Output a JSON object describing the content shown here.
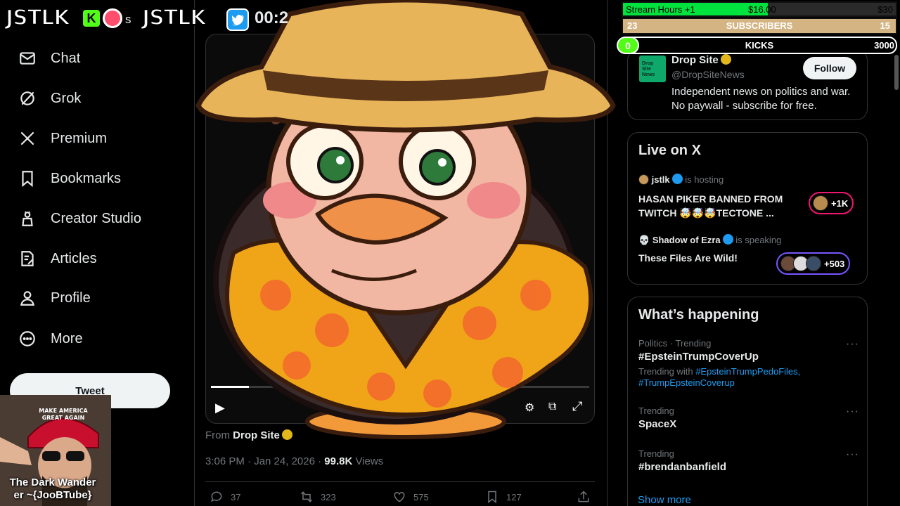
{
  "nav": {
    "items": [
      {
        "label": "Chat",
        "icon": "mail-icon"
      },
      {
        "label": "Grok",
        "icon": "grok-icon"
      },
      {
        "label": "Premium",
        "icon": "x-logo-icon"
      },
      {
        "label": "Bookmarks",
        "icon": "bookmark-icon"
      },
      {
        "label": "Creator Studio",
        "icon": "creator-studio-icon"
      },
      {
        "label": "Articles",
        "icon": "articles-icon"
      },
      {
        "label": "Profile",
        "icon": "profile-icon"
      },
      {
        "label": "More",
        "icon": "more-circle-icon"
      }
    ],
    "tweet_button": "Tweet"
  },
  "overlay": {
    "logo_left": "JSTLK",
    "kick_letter": "K",
    "s_fragment": "s",
    "logo_center": "JSTLK",
    "time_fragment": "00:2"
  },
  "post": {
    "from_prefix": "From",
    "from_name": "Drop Site",
    "time": "3:06 PM · Jan 24, 2026 ·",
    "views_count": "99.8K",
    "views_label": "Views",
    "replies": "37",
    "reposts": "323",
    "likes": "575",
    "bookmarks": "127",
    "video_progress": 0.1
  },
  "who_to_follow": {
    "name": "Drop Site",
    "handle": "@DropSiteNews",
    "bio_line1": "Independent news on politics and war.",
    "bio_line2": "No paywall - subscribe for free.",
    "follow_label": "Follow",
    "avatar_text": "Drop Site News"
  },
  "live_on_x": {
    "title": "Live on X",
    "entries": [
      {
        "host": "jstlk",
        "status": "is hosting",
        "title_line1": "HASAN PIKER BANNED FROM",
        "title_line2": "TWITCH 🤯🤯🤯TECTONE ...",
        "count": "+1K"
      },
      {
        "host": "Shadow of Ezra",
        "status": "is speaking",
        "title_line1": "These Files Are Wild!",
        "title_line2": "",
        "count": "+503"
      }
    ]
  },
  "whats_happening": {
    "title": "What’s happening",
    "trends": [
      {
        "context": "Politics · Trending",
        "name": "#EpsteinTrumpCoverUp",
        "with_prefix": "Trending with",
        "with_tag1": "#EpsteinTrumpPedoFiles,",
        "with_tag2": "#TrumpEpsteinCoverup"
      },
      {
        "context": "Trending",
        "name": "SpaceX"
      },
      {
        "context": "Trending",
        "name": "#brendanbanfield"
      }
    ],
    "dots": "···",
    "show_more": "Show more"
  },
  "stream_bars": {
    "hours_label": "Stream Hours +1",
    "hours_current": "$16.00",
    "hours_goal": "$30",
    "hours_progress": 0.53,
    "subs_current": "23",
    "subs_label": "SUBSCRIBERS",
    "subs_goal": "15",
    "kicks_current": "0",
    "kicks_label": "KICKS",
    "kicks_goal": "3000"
  },
  "webcam": {
    "label_line1": "The Dark Wander",
    "label_line2": "er ~{JooBTube}",
    "hat_line1": "MAKE AMERICA",
    "hat_line2": "GREAT AGAIN"
  },
  "colors": {
    "accent": "#1d9bf0",
    "background": "#000000",
    "border": "#2f3336",
    "kick_green": "#53fc18",
    "gold_check": "#e2b719"
  }
}
